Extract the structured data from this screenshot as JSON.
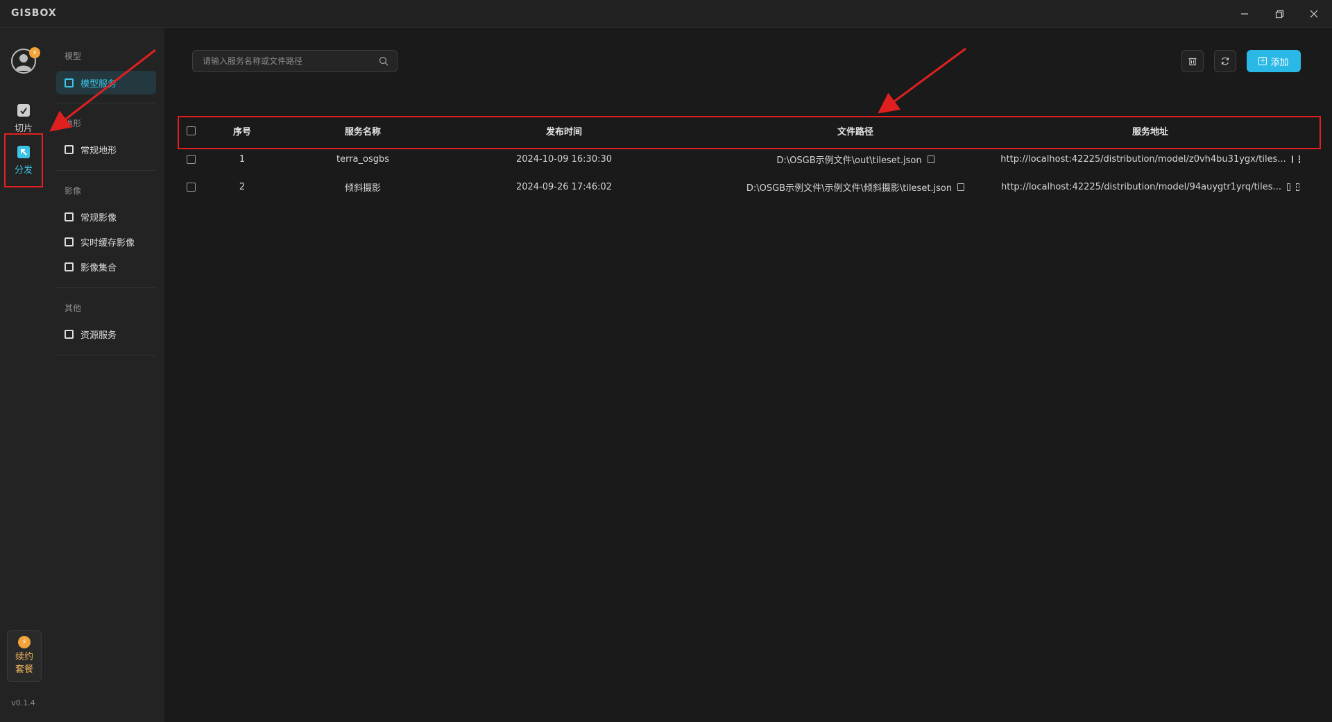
{
  "app": {
    "logo": "GISBOX"
  },
  "window": {
    "minimize": "—",
    "restore": "❐",
    "close": "✕"
  },
  "rail": {
    "items": [
      {
        "label": "切片",
        "icon": "slice-icon"
      },
      {
        "label": "分发",
        "icon": "distribute-icon"
      }
    ],
    "renew": {
      "line1": "续约",
      "line2": "套餐",
      "icon": "lightning-icon"
    },
    "version": "v0.1.4"
  },
  "subnav": {
    "groups": [
      {
        "title": "模型",
        "items": [
          {
            "label": "模型服务"
          }
        ]
      },
      {
        "title": "地形",
        "items": [
          {
            "label": "常规地形"
          }
        ]
      },
      {
        "title": "影像",
        "items": [
          {
            "label": "常规影像"
          },
          {
            "label": "实时缓存影像"
          },
          {
            "label": "影像集合"
          }
        ]
      },
      {
        "title": "其他",
        "items": [
          {
            "label": "资源服务"
          }
        ]
      }
    ]
  },
  "toolbar": {
    "search_placeholder": "请输入服务名称或文件路径",
    "add_label": "添加"
  },
  "table": {
    "headers": [
      "序号",
      "服务名称",
      "发布时间",
      "文件路径",
      "服务地址"
    ],
    "rows": [
      {
        "index": "1",
        "name": "terra_osgbs",
        "time": "2024-10-09 16:30:30",
        "path": "D:\\OSGB示例文件\\out\\tileset.json",
        "url": "http://localhost:42225/distribution/model/z0vh4bu31ygx/tiles..."
      },
      {
        "index": "2",
        "name": "倾斜摄影",
        "time": "2024-09-26 17:46:02",
        "path": "D:\\OSGB示例文件\\示例文件\\倾斜摄影\\tileset.json",
        "url": "http://localhost:42225/distribution/model/94auygtr1yrq/tiles..."
      }
    ]
  },
  "colors": {
    "accent": "#2ab8e6",
    "highlight": "#e02020",
    "badge": "#f2a33a"
  }
}
